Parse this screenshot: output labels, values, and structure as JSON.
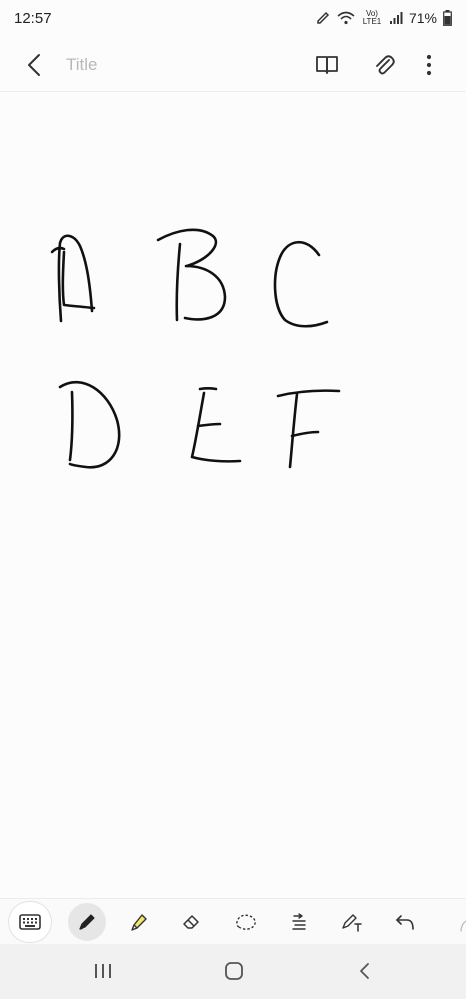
{
  "status_bar": {
    "time": "12:57",
    "network_label": "Vo) LTE1",
    "battery_text": "71%",
    "icons": [
      "edit-pen-icon",
      "wifi-icon",
      "signal-icon",
      "battery-icon"
    ]
  },
  "app_bar": {
    "title_placeholder": "Title",
    "title_value": "",
    "icons": [
      "back-arrow-icon",
      "book-icon",
      "attach-icon",
      "more-vert-icon"
    ]
  },
  "canvas": {
    "handwritten_content": [
      "A",
      "B",
      "C",
      "D",
      "E",
      "F"
    ],
    "stroke_color": "#111111"
  },
  "toolbar": {
    "tools": [
      "keyboard-icon",
      "pen-icon",
      "highlighter-icon",
      "eraser-icon",
      "lasso-icon",
      "text-align-icon",
      "pen-text-icon",
      "undo-icon"
    ],
    "active_tool": "pen",
    "highlighter_color": "#f5e66b"
  },
  "nav_bar": {
    "icons": [
      "recents-icon",
      "home-icon",
      "nav-back-icon"
    ]
  }
}
